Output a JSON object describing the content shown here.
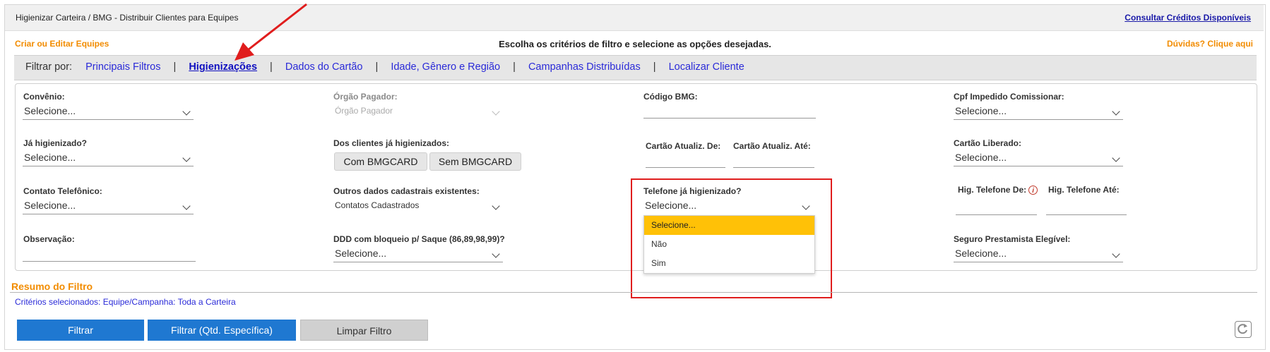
{
  "header": {
    "breadcrumb": "Higienizar Carteira / BMG - Distribuir Clientes para Equipes",
    "credits_link": "Consultar Créditos Disponíveis",
    "teams_link": "Criar ou Editar Equipes",
    "instruction": "Escolha os critérios de filtro e selecione as opções desejadas.",
    "help_link": "Dúvidas? Clique aqui"
  },
  "tabs": {
    "prefix": "Filtrar por:",
    "items": [
      {
        "label": "Principais Filtros",
        "active": false
      },
      {
        "label": "Higienizações",
        "active": true
      },
      {
        "label": "Dados do Cartão",
        "active": false
      },
      {
        "label": "Idade, Gênero e Região",
        "active": false
      },
      {
        "label": "Campanhas Distribuídas",
        "active": false
      },
      {
        "label": "Localizar Cliente",
        "active": false
      }
    ],
    "separator": "|"
  },
  "filters": {
    "convenio": {
      "label": "Convênio:",
      "value": "Selecione..."
    },
    "orgao": {
      "label": "Órgão Pagador:",
      "value": "Órgão Pagador"
    },
    "codigo_bmg": {
      "label": "Código BMG:",
      "value": ""
    },
    "cpf_impedido": {
      "label": "Cpf Impedido Comissionar:",
      "value": "Selecione..."
    },
    "ja_higienizado": {
      "label": "Já higienizado?",
      "value": "Selecione..."
    },
    "dos_clientes": {
      "label": "Dos clientes já higienizados:",
      "btn_com": "Com BMGCARD",
      "btn_sem": "Sem BMGCARD"
    },
    "cartao_de": {
      "label": "Cartão Atualiz. De:",
      "value": ""
    },
    "cartao_ate": {
      "label": "Cartão Atualiz. Até:",
      "value": ""
    },
    "cartao_liberado": {
      "label": "Cartão Liberado:",
      "value": "Selecione..."
    },
    "contato": {
      "label": "Contato Telefônico:",
      "value": "Selecione..."
    },
    "outros_dados": {
      "label": "Outros dados cadastrais existentes:",
      "value": "Contatos Cadastrados"
    },
    "telefone_higienizado": {
      "label": "Telefone já higienizado?",
      "value": "Selecione...",
      "options": [
        "Selecione...",
        "Não",
        "Sim"
      ]
    },
    "hig_tel_de": {
      "label": "Hig. Telefone De:",
      "info": "i"
    },
    "hig_tel_ate": {
      "label": "Hig. Telefone Até:"
    },
    "observacao": {
      "label": "Observação:",
      "value": ""
    },
    "ddd_bloqueio": {
      "label": "DDD com bloqueio p/ Saque (86,89,98,99)?",
      "value": "Selecione..."
    },
    "seguro": {
      "label": "Seguro Prestamista Elegível:",
      "value": "Selecione..."
    }
  },
  "summary": {
    "title": "Resumo do Filtro",
    "criteria": "Critérios selecionados: Equipe/Campanha: Toda a Carteira"
  },
  "buttons": {
    "filtrar": "Filtrar",
    "filtrar_qtd": "Filtrar (Qtd. Específica)",
    "limpar": "Limpar Filtro"
  },
  "colors": {
    "accent_orange": "#f28c00",
    "link_blue": "#2a2ad8",
    "button_blue": "#1f78d1",
    "highlight": "#ffc107",
    "annotation_red": "#e01d1d"
  }
}
